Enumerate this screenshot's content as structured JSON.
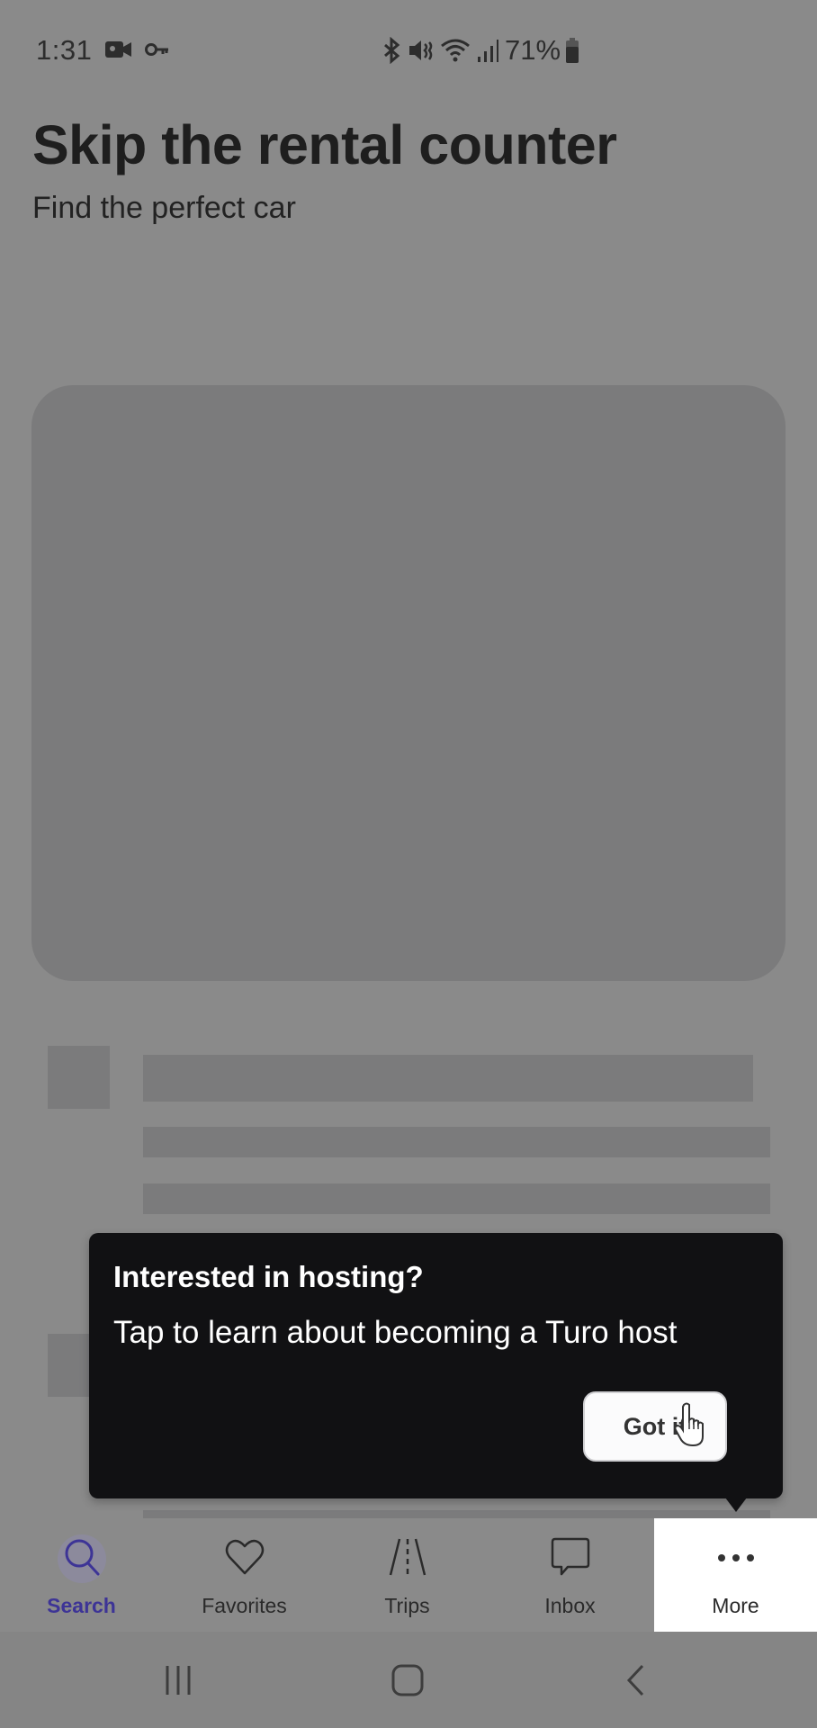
{
  "status_bar": {
    "time": "1:31",
    "left_icons": [
      "video-recording-icon",
      "vpn-key-icon"
    ],
    "right_icons": [
      "bluetooth-icon",
      "mute-icon",
      "wifi-icon",
      "signal-icon",
      "battery-icon"
    ],
    "battery_percent": "71%"
  },
  "header": {
    "title": "Skip the rental counter",
    "subtitle": "Find the perfect car"
  },
  "tooltip": {
    "title": "Interested in hosting?",
    "body": "Tap to learn about becoming a Turo host",
    "button_label": "Got it"
  },
  "bottom_nav": {
    "active": "Search",
    "items": [
      {
        "label": "Search",
        "icon": "search-icon"
      },
      {
        "label": "Favorites",
        "icon": "heart-icon"
      },
      {
        "label": "Trips",
        "icon": "road-icon"
      },
      {
        "label": "Inbox",
        "icon": "chat-bubble-icon"
      },
      {
        "label": "More",
        "icon": "more-dots-icon"
      }
    ]
  },
  "system_nav": {
    "buttons": [
      "recent-apps",
      "home",
      "back"
    ]
  },
  "colors": {
    "accent": "#3d3496",
    "tooltip_bg": "#111113",
    "dim_overlay_bg": "#8a8a8a",
    "highlight_bg": "#ffffff"
  }
}
